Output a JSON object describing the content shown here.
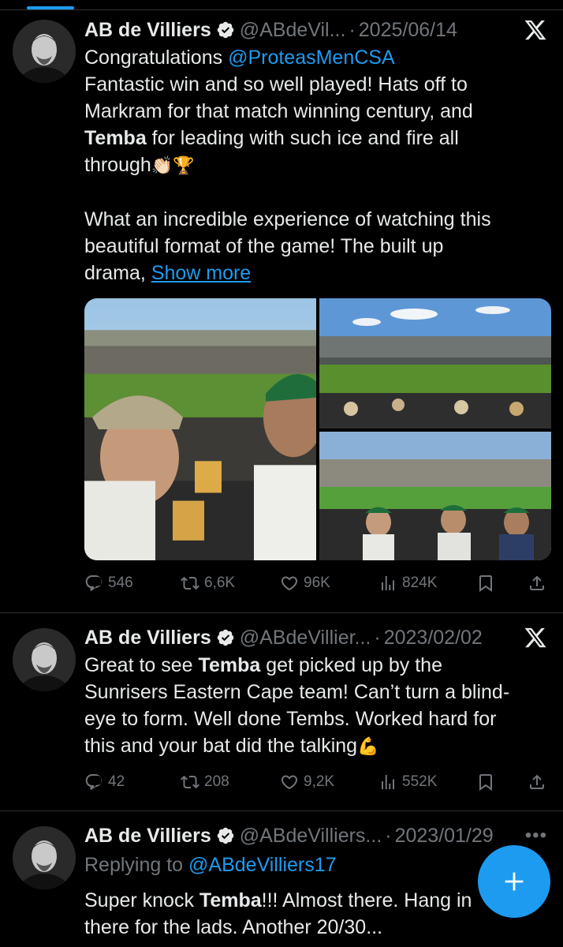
{
  "tweets": [
    {
      "author": "AB de Villiers",
      "handle": "@ABdeVil...",
      "sep": "·",
      "date": "2025/06/14",
      "text_l1_pre": "Congratulations ",
      "text_l1_mention": "@ProteasMenCSA",
      "text_l2": "Fantastic win and so well played! Hats off to",
      "text_l3": "Markram for that match winning century, and",
      "text_l4_bold": "Temba",
      "text_l4_rest": " for leading with such ice and fire all",
      "text_l5": "through",
      "text_l5_emoji": "👏🏻🏆",
      "text_l6": "What an incredible experience of watching this",
      "text_l7": "beautiful format of the game! The built up",
      "text_l8_pre": "drama, ",
      "show_more": "Show more",
      "replies": "546",
      "reposts": "6,6K",
      "likes": "96K",
      "views": "824K"
    },
    {
      "author": "AB de Villiers",
      "handle": "@ABdeVillier...",
      "sep": "·",
      "date": "2023/02/02",
      "text_l1_pre": "Great to see ",
      "text_l1_bold": "Temba",
      "text_l1_rest": " get picked up by the",
      "text_l2": "Sunrisers Eastern Cape team! Can’t turn a blind-",
      "text_l3": "eye to form. Well done Tembs. Worked hard for",
      "text_l4": "this and your bat did the talking",
      "text_l4_emoji": "💪",
      "replies": "42",
      "reposts": "208",
      "likes": "9,2K",
      "views": "552K"
    },
    {
      "author": "AB de Villiers",
      "handle": "@ABdeVilliers...",
      "sep": "·",
      "date": "2023/01/29",
      "more": "•••",
      "replying_label": "Replying to ",
      "replying_to": "@ABdeVilliers17",
      "text_l1_pre": "Super knock ",
      "text_l1_bold": "Temba",
      "text_l1_rest": "!!! Almost there. Hang in",
      "text_l2": "there for the lads. Another 20/30..."
    }
  ],
  "icons": {
    "verified": "verified-badge-icon",
    "x_logo": "x-logo-icon",
    "reply": "reply-icon",
    "repost": "repost-icon",
    "like": "heart-icon",
    "views": "views-icon",
    "bookmark": "bookmark-icon",
    "share": "share-icon",
    "compose": "compose-plus-icon"
  },
  "colors": {
    "background": "#000000",
    "accent": "#1d9bf0",
    "text": "#e7e9ea",
    "muted": "#71767b",
    "divider": "#2f3336"
  }
}
